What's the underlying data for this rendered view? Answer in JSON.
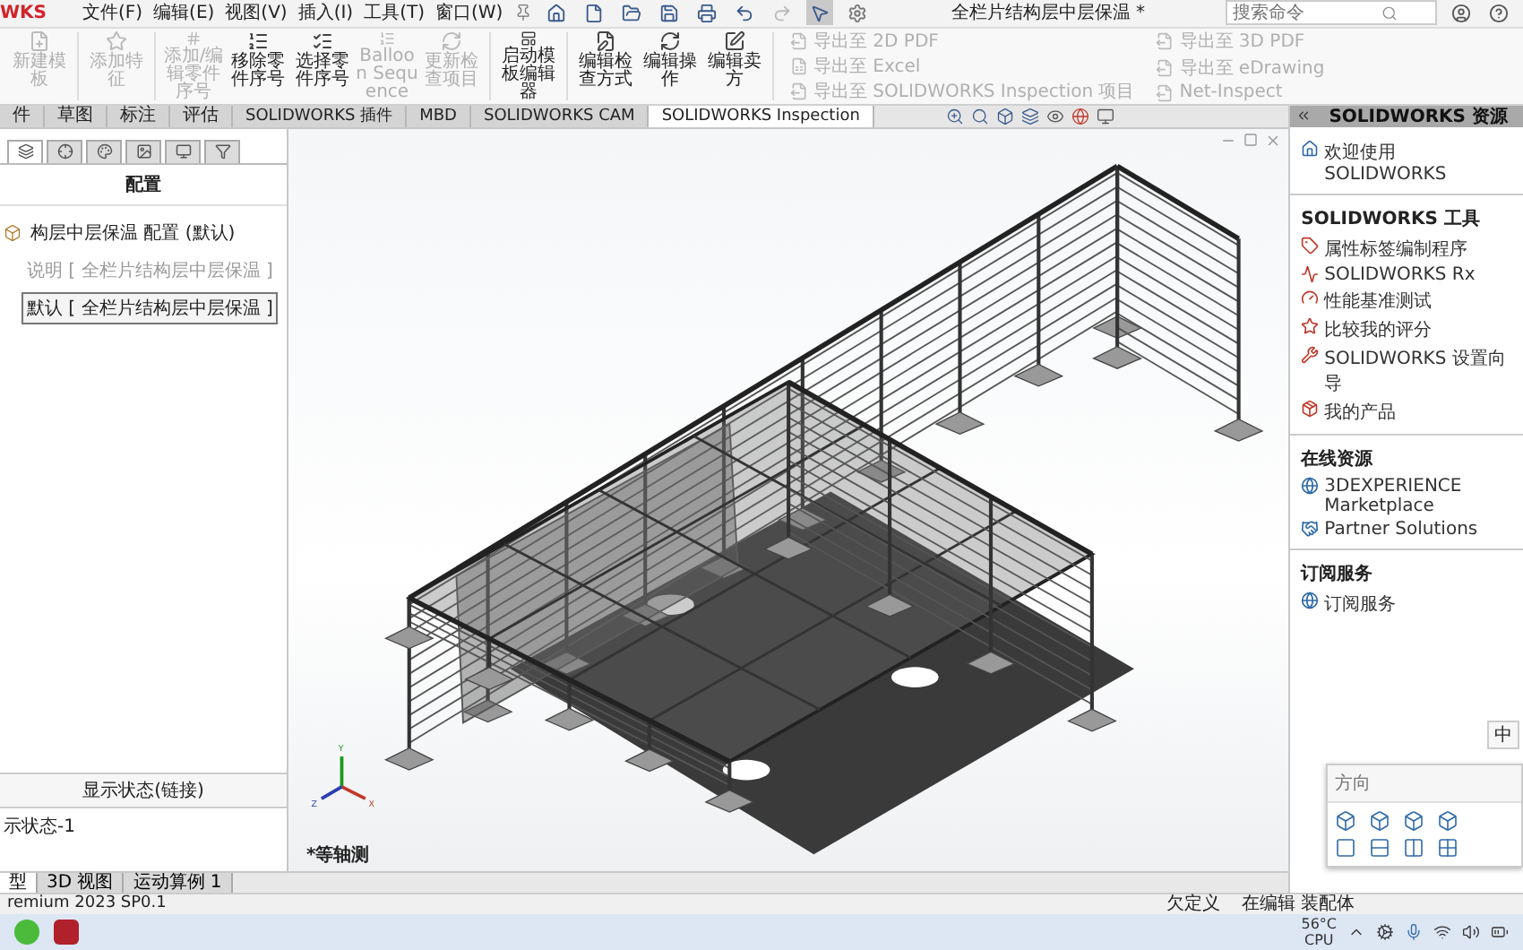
{
  "app": {
    "logo": "WKS"
  },
  "menu": [
    "文件(F)",
    "编辑(E)",
    "视图(V)",
    "插入(I)",
    "工具(T)",
    "窗口(W)"
  ],
  "title": "全栏片结构层中层保温 *",
  "search": {
    "placeholder": "搜索命令"
  },
  "ribbon": [
    {
      "label": "新建模板",
      "disabled": true
    },
    {
      "label": "添加特征",
      "disabled": true
    },
    {
      "label": "添加/编辑零件序号",
      "disabled": true
    },
    {
      "label": "移除零件序号",
      "disabled": false
    },
    {
      "label": "选择零件序号",
      "disabled": false
    },
    {
      "label": "Balloon Sequence",
      "disabled": true
    },
    {
      "label": "更新检查项目",
      "disabled": true
    },
    {
      "label": "启动模板编辑器",
      "disabled": false
    },
    {
      "label": "编辑检查方式",
      "disabled": false
    },
    {
      "label": "编辑操作",
      "disabled": false
    },
    {
      "label": "编辑卖方",
      "disabled": false
    }
  ],
  "exports": [
    {
      "label": "导出至 2D PDF",
      "disabled": true
    },
    {
      "label": "导出至 Excel",
      "disabled": true
    },
    {
      "label": "导出至 SOLIDWORKS Inspection 项目",
      "disabled": true
    },
    {
      "label": "导出至 3D PDF",
      "disabled": true
    },
    {
      "label": "导出至 eDrawing",
      "disabled": true
    },
    {
      "label": "Net-Inspect",
      "disabled": true
    }
  ],
  "tabs": [
    {
      "label": "件",
      "selected": false
    },
    {
      "label": "草图",
      "selected": false
    },
    {
      "label": "标注",
      "selected": false
    },
    {
      "label": "评估",
      "selected": false
    },
    {
      "label": "SOLIDWORKS 插件",
      "selected": false
    },
    {
      "label": "MBD",
      "selected": false
    },
    {
      "label": "SOLIDWORKS CAM",
      "selected": false
    },
    {
      "label": "SOLIDWORKS Inspection",
      "selected": true
    }
  ],
  "sidebar": {
    "panel_tabs": [
      {
        "selected": true
      },
      {
        "selected": false
      },
      {
        "selected": false
      },
      {
        "selected": false
      },
      {
        "selected": false
      },
      {
        "selected": false
      }
    ],
    "heading": "配置",
    "tree": [
      {
        "label": "构层中层保温 配置 (默认)",
        "selected": false,
        "disabled": false,
        "children": [
          {
            "label": "说明 [ 全栏片结构层中层保温 ]",
            "selected": false,
            "disabled": true
          },
          {
            "label": "默认 [ 全栏片结构层中层保温 ]",
            "selected": true,
            "disabled": false
          }
        ]
      }
    ],
    "display_heading": "显示状态(链接)",
    "display_items": [
      "示状态-1"
    ]
  },
  "viewport": {
    "view_label": "*等轴测",
    "axes": [
      "Y",
      "X",
      "Z"
    ]
  },
  "task_pane": {
    "title": "SOLIDWORKS 资源",
    "welcome": "欢迎使用 SOLIDWORKS",
    "sections": [
      {
        "title": "SOLIDWORKS 工具",
        "items": [
          "属性标签编制程序",
          "SOLIDWORKS Rx",
          "性能基准测试",
          "比较我的评分",
          "SOLIDWORKS 设置向导",
          "我的产品"
        ]
      },
      {
        "title": "在线资源",
        "items": [
          "3DEXPERIENCE Marketplace",
          "Partner Solutions"
        ]
      },
      {
        "title": "订阅服务",
        "items": [
          "订阅服务"
        ]
      }
    ]
  },
  "ime": {
    "label": "中"
  },
  "orientation": {
    "title": "方向"
  },
  "bottom_tabs": [
    {
      "label": "型",
      "selected": true
    },
    {
      "label": "3D 视图",
      "selected": false
    },
    {
      "label": "运动算例 1",
      "selected": false
    }
  ],
  "status_bar": {
    "version": "remium 2023 SP0.1",
    "state": "欠定义",
    "mode": "在编辑 装配体"
  },
  "taskbar": {
    "temperature": "56°C",
    "sensor": "CPU"
  }
}
